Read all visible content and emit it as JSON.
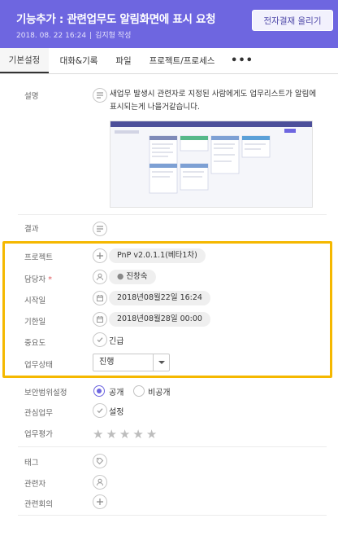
{
  "header": {
    "title": "기능추가 : 관련업무도 알림화면에 표시 요청",
    "date": "2018. 08. 22 16:24",
    "author": "김지형 작성",
    "approval_button": "전자결재 올리기",
    "color": "#6e66e0"
  },
  "tabs": [
    {
      "label": "기본설정",
      "active": true
    },
    {
      "label": "대화&기록"
    },
    {
      "label": "파일"
    },
    {
      "label": "프로젝트/프로세스"
    },
    {
      "label": "•••"
    }
  ],
  "fields": {
    "description": {
      "label": "설명",
      "text": "새업무 발생시 관련자로 지정된 사람에게도 업무리스트가 알림에 표시되는게 나을거같습니다."
    },
    "result": {
      "label": "결과"
    },
    "project": {
      "label": "프로젝트",
      "value": "PnP v2.0.1.1(베타1차)"
    },
    "assignee": {
      "label": "담당자",
      "required_mark": "*",
      "value": "진창숙"
    },
    "start_date": {
      "label": "시작일",
      "value": "2018년08월22일 16:24"
    },
    "due_date": {
      "label": "기한일",
      "value": "2018년08월28일 00:00"
    },
    "priority": {
      "label": "중요도",
      "value": "긴급"
    },
    "status": {
      "label": "업무상태",
      "value": "진행"
    },
    "visibility": {
      "label": "보안범위설정",
      "options": [
        "공개",
        "비공개"
      ],
      "selected": "공개"
    },
    "interest": {
      "label": "관심업무",
      "value": "설정"
    },
    "evaluation": {
      "label": "업무평가",
      "rating": 0,
      "max": 5
    },
    "tag": {
      "label": "태그"
    },
    "related_people": {
      "label": "관련자"
    },
    "related_meeting": {
      "label": "관련회의"
    }
  },
  "highlight_color": "#f5b800"
}
